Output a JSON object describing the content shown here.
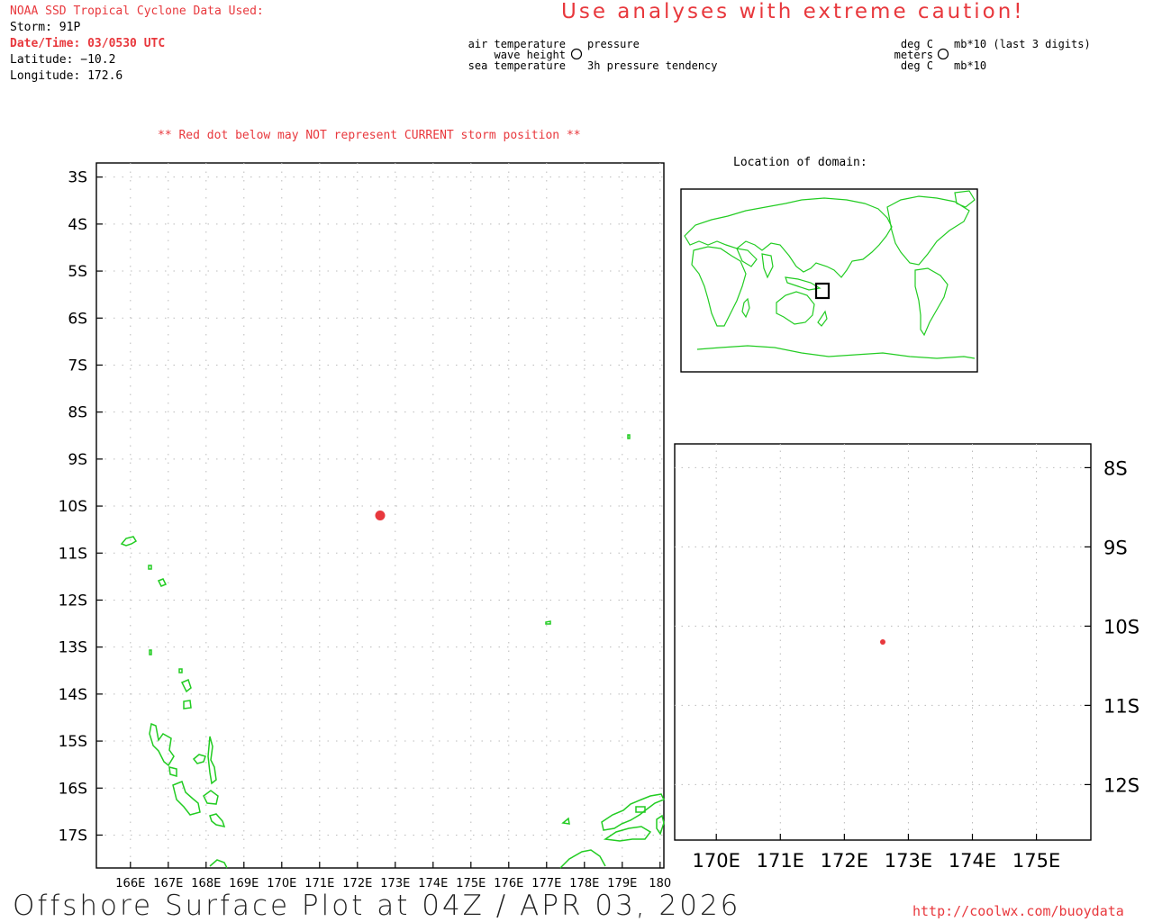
{
  "header": {
    "source_line": "NOAA SSD Tropical Cyclone Data Used:",
    "storm": "Storm: 91P",
    "datetime": "Date/Time: 03/0530 UTC",
    "latitude": "Latitude: −10.2",
    "longitude": "Longitude: 172.6",
    "caution": "Use analyses with extreme caution!"
  },
  "legend": {
    "air_temperature": "air temperature",
    "wave_height": "wave height",
    "sea_temperature": "sea temperature",
    "pressure": "pressure",
    "pressure_tendency": "3h pressure tendency",
    "deg_c_1": "deg C",
    "meters": "meters",
    "deg_c_2": "deg C",
    "mb_last3": "mb*10 (last 3 digits)",
    "mb10": "mb*10"
  },
  "warning": "** Red dot below may NOT represent CURRENT storm position **",
  "inset_title": "Location of domain:",
  "main_map": {
    "lat_labels": [
      "3S",
      "4S",
      "5S",
      "6S",
      "7S",
      "8S",
      "9S",
      "10S",
      "11S",
      "12S",
      "13S",
      "14S",
      "15S",
      "16S",
      "17S"
    ],
    "lon_labels": [
      "166E",
      "167E",
      "168E",
      "169E",
      "170E",
      "171E",
      "172E",
      "173E",
      "174E",
      "175E",
      "176E",
      "177E",
      "178E",
      "179E",
      "180"
    ],
    "storm_position": {
      "lat": -10.2,
      "lon": 172.6
    },
    "coastline_color": "#22cc22",
    "storm_color": "#e8383d"
  },
  "zoom_map": {
    "lat_labels": [
      "8S",
      "9S",
      "10S",
      "11S",
      "12S"
    ],
    "lon_labels": [
      "170E",
      "171E",
      "172E",
      "173E",
      "174E",
      "175E"
    ],
    "storm_position": {
      "lat": -10.2,
      "lon": 172.6
    }
  },
  "footer": {
    "title": "Offshore Surface Plot at 04Z / APR 03, 2026",
    "url": "http://coolwx.com/buoydata"
  }
}
